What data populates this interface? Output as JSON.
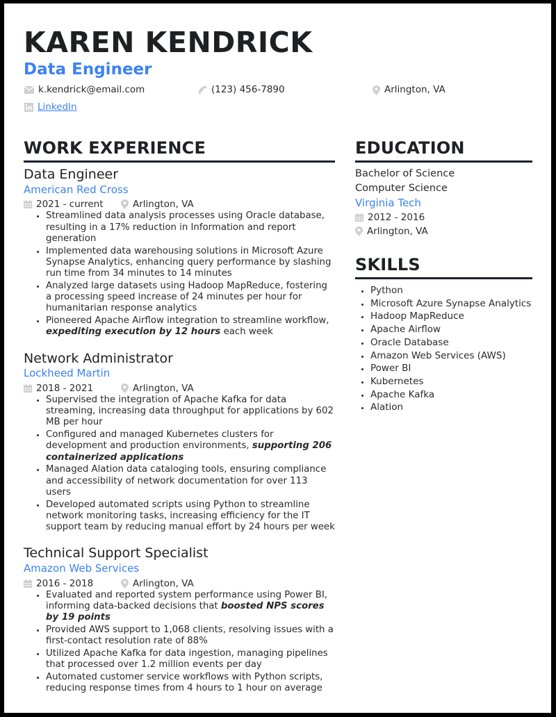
{
  "header": {
    "name": "KAREN KENDRICK",
    "role": "Data Engineer",
    "email": "k.kendrick@email.com",
    "phone": "(123) 456-7890",
    "location": "Arlington, VA",
    "linkedin": "LinkedIn"
  },
  "colors": {
    "accent": "#3b82f0",
    "heading": "#1f2024",
    "rule": "#1a1f2b",
    "icon": "#c8c8c8",
    "border": "#000000"
  },
  "work": {
    "title": "WORK EXPERIENCE",
    "jobs": [
      {
        "title": "Data Engineer",
        "company": "American Red Cross",
        "dates": "2021 - current",
        "location": "Arlington, VA",
        "bullets": [
          {
            "text": "Streamlined data analysis processes using Oracle database, resulting in a 17% reduction in Information and report generation"
          },
          {
            "text": "Implemented data warehousing solutions in Microsoft Azure Synapse Analytics, enhancing query performance by slashing run time from 34 minutes to 14 minutes"
          },
          {
            "text": "Analyzed large datasets using Hadoop MapReduce, fostering a processing speed increase of 24 minutes per hour for humanitarian response analytics"
          },
          {
            "pre": "Pioneered Apache Airflow integration to streamline workflow, ",
            "em": "expediting execution by 12 hours",
            "post": " each week"
          }
        ]
      },
      {
        "title": "Network Administrator",
        "company": "Lockheed Martin",
        "dates": "2018 - 2021",
        "location": "Arlington, VA",
        "bullets": [
          {
            "text": "Supervised the integration of Apache Kafka for data streaming, increasing data throughput for applications by 602 MB per hour"
          },
          {
            "pre": "Configured and managed Kubernetes clusters for development and production environments, ",
            "em": "supporting 206 containerized applications",
            "post": ""
          },
          {
            "text": "Managed Alation data cataloging tools, ensuring compliance and accessibility of network documentation for over 113 users"
          },
          {
            "text": "Developed automated scripts using Python to streamline network monitoring tasks, increasing efficiency for the IT support team by reducing manual effort by 24 hours per week"
          }
        ]
      },
      {
        "title": "Technical Support Specialist",
        "company": "Amazon Web Services",
        "dates": "2016 - 2018",
        "location": "Arlington, VA",
        "bullets": [
          {
            "pre": "Evaluated and reported system performance using Power BI, informing data-backed decisions that ",
            "em": "boosted NPS scores by 19 points",
            "post": ""
          },
          {
            "text": "Provided AWS support to 1,068 clients, resolving issues with a first-contact resolution rate of 88%"
          },
          {
            "text": "Utilized Apache Kafka for data ingestion, managing pipelines that processed over 1.2 million events per day"
          },
          {
            "text": "Automated customer service workflows with Python scripts, reducing response times from 4 hours to 1 hour on average"
          }
        ]
      }
    ]
  },
  "education": {
    "title": "EDUCATION",
    "degree": "Bachelor of Science",
    "field": "Computer Science",
    "school": "Virginia Tech",
    "dates": "2012 - 2016",
    "location": "Arlington, VA"
  },
  "skills": {
    "title": "SKILLS",
    "items": [
      "Python",
      "Microsoft Azure Synapse Analytics",
      "Hadoop MapReduce",
      "Apache Airflow",
      "Oracle Database",
      "Amazon Web Services (AWS)",
      "Power BI",
      "Kubernetes",
      "Apache Kafka",
      "Alation"
    ]
  }
}
